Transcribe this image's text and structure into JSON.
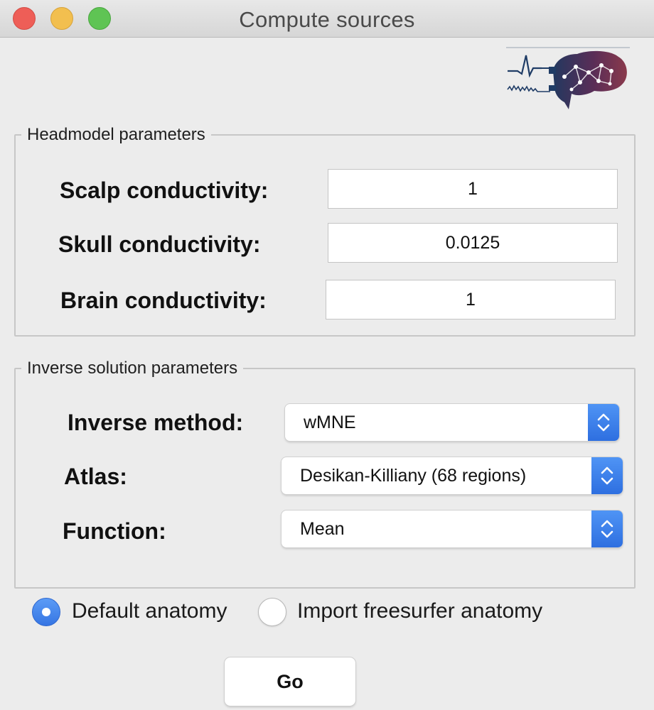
{
  "window": {
    "title": "Compute sources"
  },
  "logo": {
    "icon": "brain-network-logo-icon"
  },
  "headmodel": {
    "legend": "Headmodel parameters",
    "scalp": {
      "label": "Scalp conductivity:",
      "value": "1"
    },
    "skull": {
      "label": "Skull conductivity:",
      "value": "0.0125"
    },
    "brain": {
      "label": "Brain conductivity:",
      "value": "1"
    }
  },
  "inverse": {
    "legend": "Inverse solution parameters",
    "method": {
      "label": "Inverse method:",
      "value": "wMNE"
    },
    "atlas": {
      "label": "Atlas:",
      "value": "Desikan-Killiany (68 regions)"
    },
    "function": {
      "label": "Function:",
      "value": "Mean"
    }
  },
  "anatomy": {
    "default_label": "Default anatomy",
    "import_label": "Import freesurfer anatomy",
    "selected": "default"
  },
  "actions": {
    "go_label": "Go"
  },
  "colors": {
    "accent": "#3a7be8",
    "close": "#ee5e57",
    "minimize": "#f2bf4f",
    "maximize": "#5fc454",
    "logo_brain": "#6a2e4a",
    "logo_line": "#1f3c66"
  }
}
